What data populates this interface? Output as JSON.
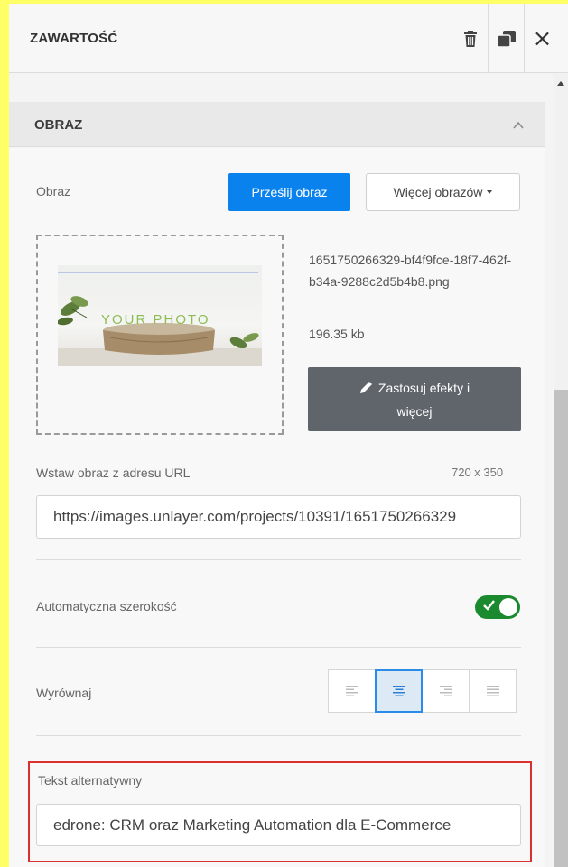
{
  "header": {
    "title": "ZAWARTOŚĆ",
    "delete_icon": "trash-icon",
    "duplicate_icon": "duplicate-icon",
    "close_label": "×"
  },
  "section": {
    "title": "OBRAZ",
    "image_label": "Obraz",
    "upload_button": "Prześlij obraz",
    "more_images_button": "Więcej obrazów",
    "thumbnail_text": "YOUR PHOTO",
    "file_name": "1651750266329-bf4f9fce-18f7-462f-b34a-9288c2d5b4b8.png",
    "file_size": "196.35 kb",
    "effects_button_line1": "Zastosuj efekty i",
    "effects_button_line2": "więcej",
    "url_label": "Wstaw obraz z adresu URL",
    "dimensions": "720 x 350",
    "url_value": "https://images.unlayer.com/projects/10391/1651750266329",
    "auto_width_label": "Automatyczna szerokość",
    "auto_width_on": true,
    "align_label": "Wyrównaj",
    "align_options": [
      "left",
      "center",
      "right",
      "justify"
    ],
    "align_selected": "center",
    "alt_label": "Tekst alternatywny",
    "alt_value": "edrone: CRM oraz Marketing Automation dla E-Commerce"
  },
  "colors": {
    "accent": "#0a82ee",
    "toggle": "#1b8a2f",
    "highlight": "#d93030",
    "outer_background": "#ffff66"
  }
}
